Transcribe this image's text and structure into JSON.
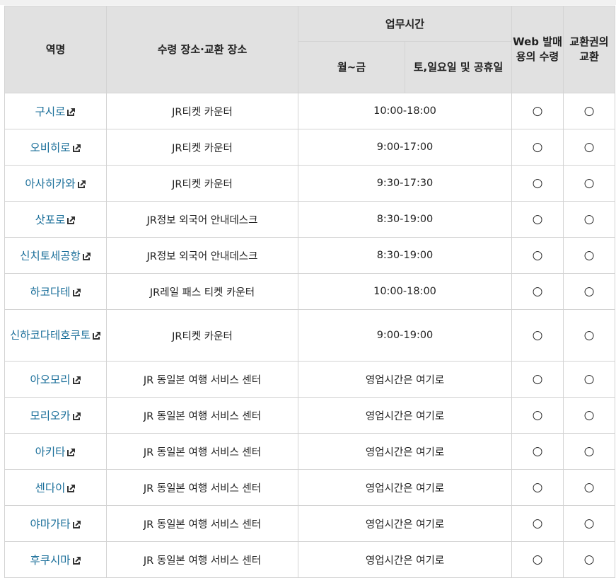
{
  "headers": {
    "station": "역명",
    "location": "수령 장소·교환 장소",
    "hours": "업무시간",
    "weekday": "월~금",
    "weekend": "토,일요일 및 공휴일",
    "web_pickup": "Web 발매용의 수령",
    "voucher_exchange": "교환권의 교환"
  },
  "rows": [
    {
      "station": "구시로",
      "location": "JR티켓 카운터",
      "hours": "10:00-18:00",
      "web": "○",
      "exchange": "○"
    },
    {
      "station": "오비히로",
      "location": "JR티켓 카운터",
      "hours": "9:00-17:00",
      "web": "○",
      "exchange": "○"
    },
    {
      "station": "아사히카와",
      "location": "JR티켓 카운터",
      "hours": "9:30-17:30",
      "web": "○",
      "exchange": "○"
    },
    {
      "station": "삿포로",
      "location": "JR정보 외국어 안내데스크",
      "hours": "8:30-19:00",
      "web": "○",
      "exchange": "○"
    },
    {
      "station": "신치토세공항",
      "location": "JR정보 외국어 안내데스크",
      "hours": "8:30-19:00",
      "web": "○",
      "exchange": "○"
    },
    {
      "station": "하코다테",
      "location": "JR레일 패스 티켓 카운터",
      "hours": "10:00-18:00",
      "web": "○",
      "exchange": "○"
    },
    {
      "station": "신하코다테호쿠토",
      "location": "JR티켓 카운터",
      "hours": "9:00-19:00",
      "web": "○",
      "exchange": "○"
    },
    {
      "station": "아오모리",
      "location": "JR 동일본 여행 서비스 센터",
      "hours": "영업시간은 여기로",
      "web": "○",
      "exchange": "○"
    },
    {
      "station": "모리오카",
      "location": "JR 동일본 여행 서비스 센터",
      "hours": "영업시간은 여기로",
      "web": "○",
      "exchange": "○"
    },
    {
      "station": "아키타",
      "location": "JR 동일본 여행 서비스 센터",
      "hours": "영업시간은 여기로",
      "web": "○",
      "exchange": "○"
    },
    {
      "station": "센다이",
      "location": "JR 동일본 여행 서비스 센터",
      "hours": "영업시간은 여기로",
      "web": "○",
      "exchange": "○"
    },
    {
      "station": "야마가타",
      "location": "JR 동일본 여행 서비스 센터",
      "hours": "영업시간은 여기로",
      "web": "○",
      "exchange": "○"
    },
    {
      "station": "후쿠시마",
      "location": "JR 동일본 여행 서비스 센터",
      "hours": "영업시간은 여기로",
      "web": "○",
      "exchange": "○"
    }
  ],
  "icons": {
    "station_link": "external-link-icon",
    "available": "circle-mark-icon"
  },
  "colors": {
    "header_bg": "#e1e1e1",
    "link": "#1b6f9a",
    "border": "#d3d3d3"
  }
}
